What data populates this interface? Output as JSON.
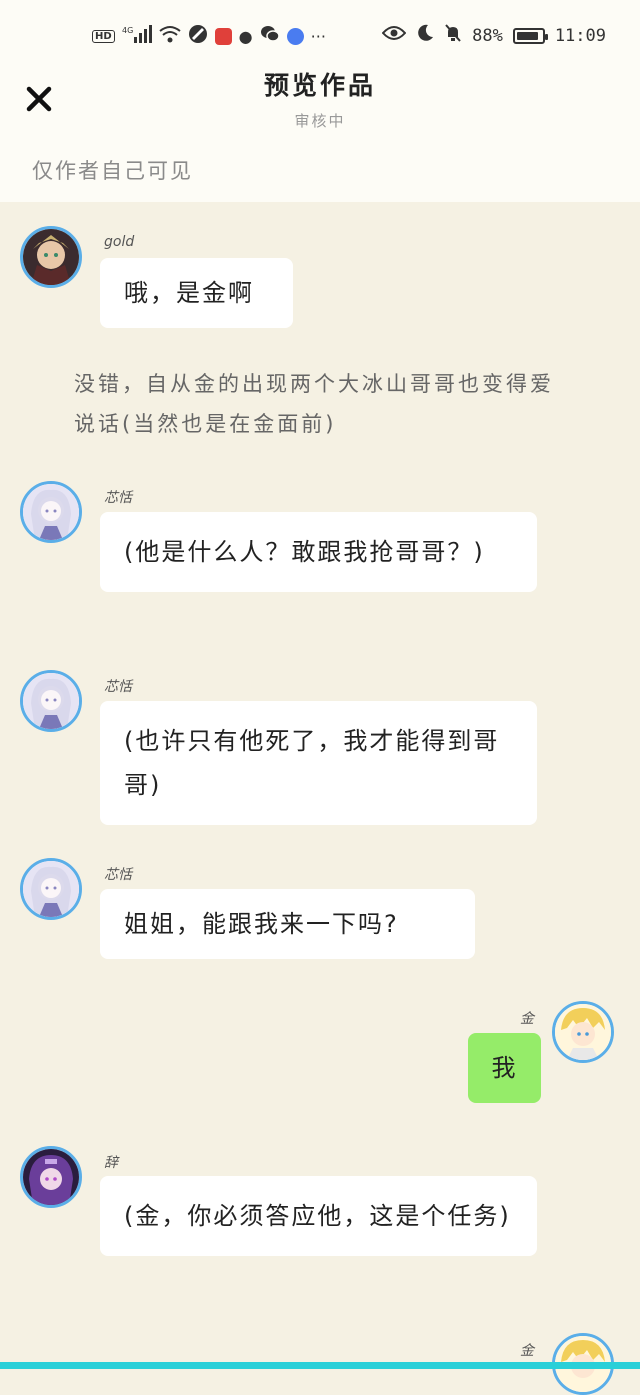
{
  "status_bar": {
    "network": "4G",
    "hd_label": "HD",
    "battery_pct": "88%",
    "battery_level": 0.88,
    "time": "11:09",
    "more": "···"
  },
  "header": {
    "title": "预览作品",
    "subtitle": "审核中",
    "visibility_note": "仅作者自己可见"
  },
  "messages": [
    {
      "speaker": "gold",
      "text": "哦，是金啊"
    },
    {
      "narration": "没错，自从金的出现两个大冰山哥哥也变得爱说话(当然也是在金面前)"
    },
    {
      "speaker": "芯恬",
      "text": "(他是什么人？敢跟我抢哥哥？)"
    },
    {
      "speaker": "芯恬",
      "text": "(也许只有他死了，我才能得到哥哥)"
    },
    {
      "speaker": "芯恬",
      "text": "姐姐，能跟我来一下吗?"
    },
    {
      "speaker": "金",
      "text": "我",
      "side": "right"
    },
    {
      "speaker": "辞",
      "text": "(金，你必须答应他，这是个任务)"
    },
    {
      "speaker": "金",
      "side": "right"
    }
  ],
  "colors": {
    "background": "#f5f1e3",
    "header_bg": "#fdfcf6",
    "bubble": "#ffffff",
    "my_bubble": "#95ec69",
    "avatar_ring": "#5aaee8"
  }
}
